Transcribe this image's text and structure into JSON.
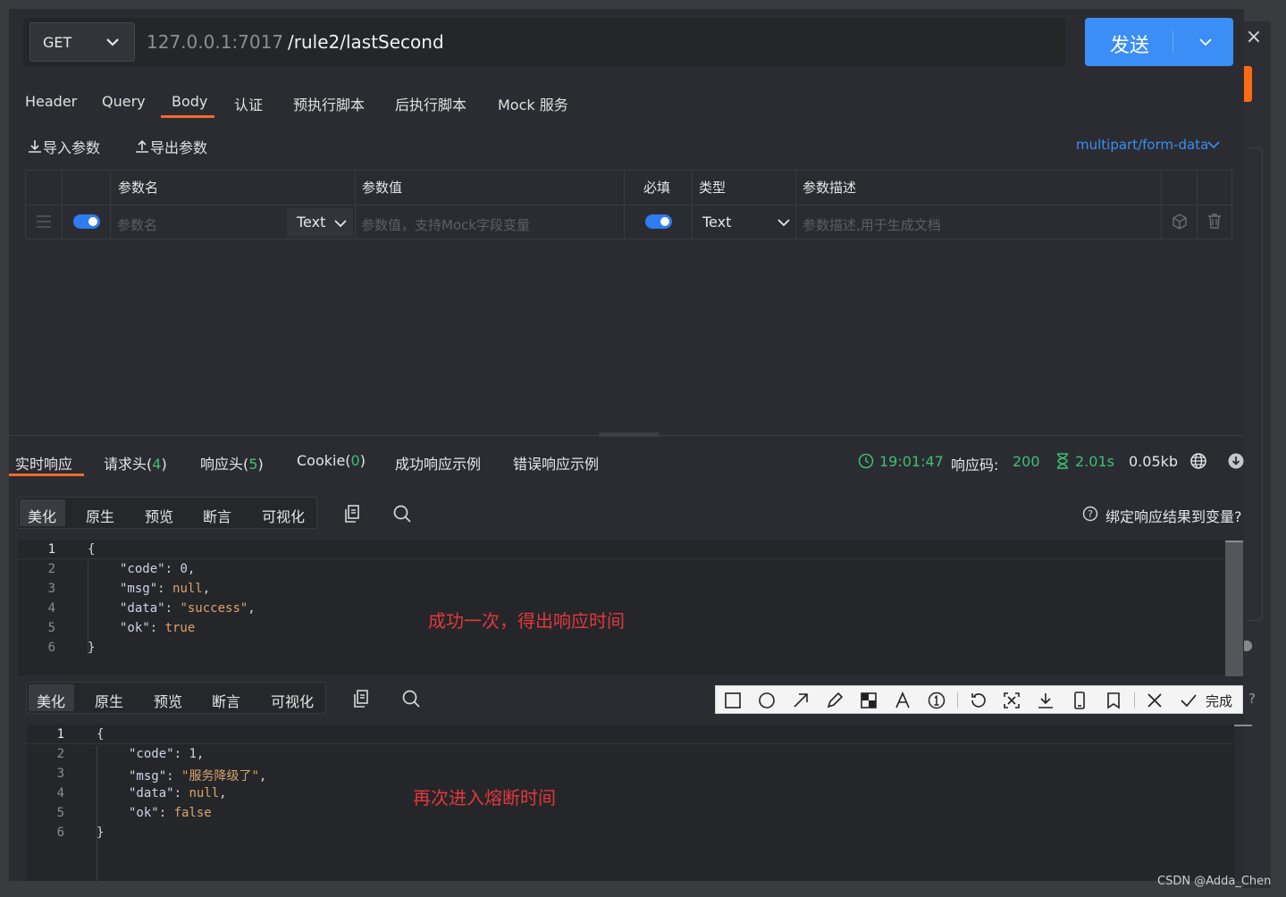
{
  "request": {
    "method": "GET",
    "url_host": "127.0.0.1:7017",
    "url_path": "/rule2/lastSecond",
    "send_label": "发送"
  },
  "tabs": [
    "Header",
    "Query",
    "Body",
    "认证",
    "预执行脚本",
    "后执行脚本",
    "Mock 服务"
  ],
  "active_tab": "Body",
  "body_toolbar": {
    "import_label": "导入参数",
    "export_label": "导出参数",
    "content_type": "multipart/form-data"
  },
  "params_table": {
    "headers": [
      "参数名",
      "参数值",
      "必填",
      "类型",
      "参数描述"
    ],
    "row": {
      "name_placeholder": "参数名",
      "name_type": "Text",
      "value_placeholder": "参数值，支持Mock字段变量",
      "type": "Text",
      "desc_placeholder": "参数描述,用于生成文档"
    }
  },
  "response_tabs": {
    "realtime": "实时响应",
    "req_headers": "请求头(",
    "req_headers_count": "4",
    "resp_headers": "响应头(",
    "resp_headers_count": "5",
    "cookie": "Cookie(",
    "cookie_count": "0",
    "close_paren": ")",
    "success_example": "成功响应示例",
    "error_example": "错误响应示例"
  },
  "response_meta": {
    "time": "19:01:47",
    "code_label": "响应码:",
    "code": "200",
    "duration": "2.01s",
    "size": "0.05kb"
  },
  "view_tabs": [
    "美化",
    "原生",
    "预览",
    "断言",
    "可视化"
  ],
  "bind_label": "绑定响应结果到变量?",
  "bind_tail": "?",
  "response1": {
    "line_numbers": [
      "1",
      "2",
      "3",
      "4",
      "5",
      "6"
    ],
    "open": "{",
    "close": "}",
    "code_key": "\"code\"",
    "code_val": "0",
    "msg_key": "\"msg\"",
    "msg_val": "null",
    "data_key": "\"data\"",
    "data_val": "\"success\"",
    "ok_key": "\"ok\"",
    "ok_val": "true",
    "annotation": "成功一次，得出响应时间"
  },
  "response2": {
    "line_numbers": [
      "1",
      "2",
      "3",
      "4",
      "5",
      "6"
    ],
    "open": "{",
    "close": "}",
    "code_key": "\"code\"",
    "code_val": "1",
    "msg_key": "\"msg\"",
    "msg_val": "\"服务降级了\"",
    "data_key": "\"data\"",
    "data_val": "null",
    "ok_key": "\"ok\"",
    "ok_val": "false",
    "annotation": "再次进入熔断时间"
  },
  "screenshot_toolbar": {
    "done_label": "完成"
  },
  "watermark": "CSDN @Adda_Chen",
  "colors": {
    "accent_blue": "#3b8ef5",
    "active_tab_orange": "#ef6b2c",
    "status_green": "#3fbf76",
    "annotation_red": "#e2383a"
  }
}
